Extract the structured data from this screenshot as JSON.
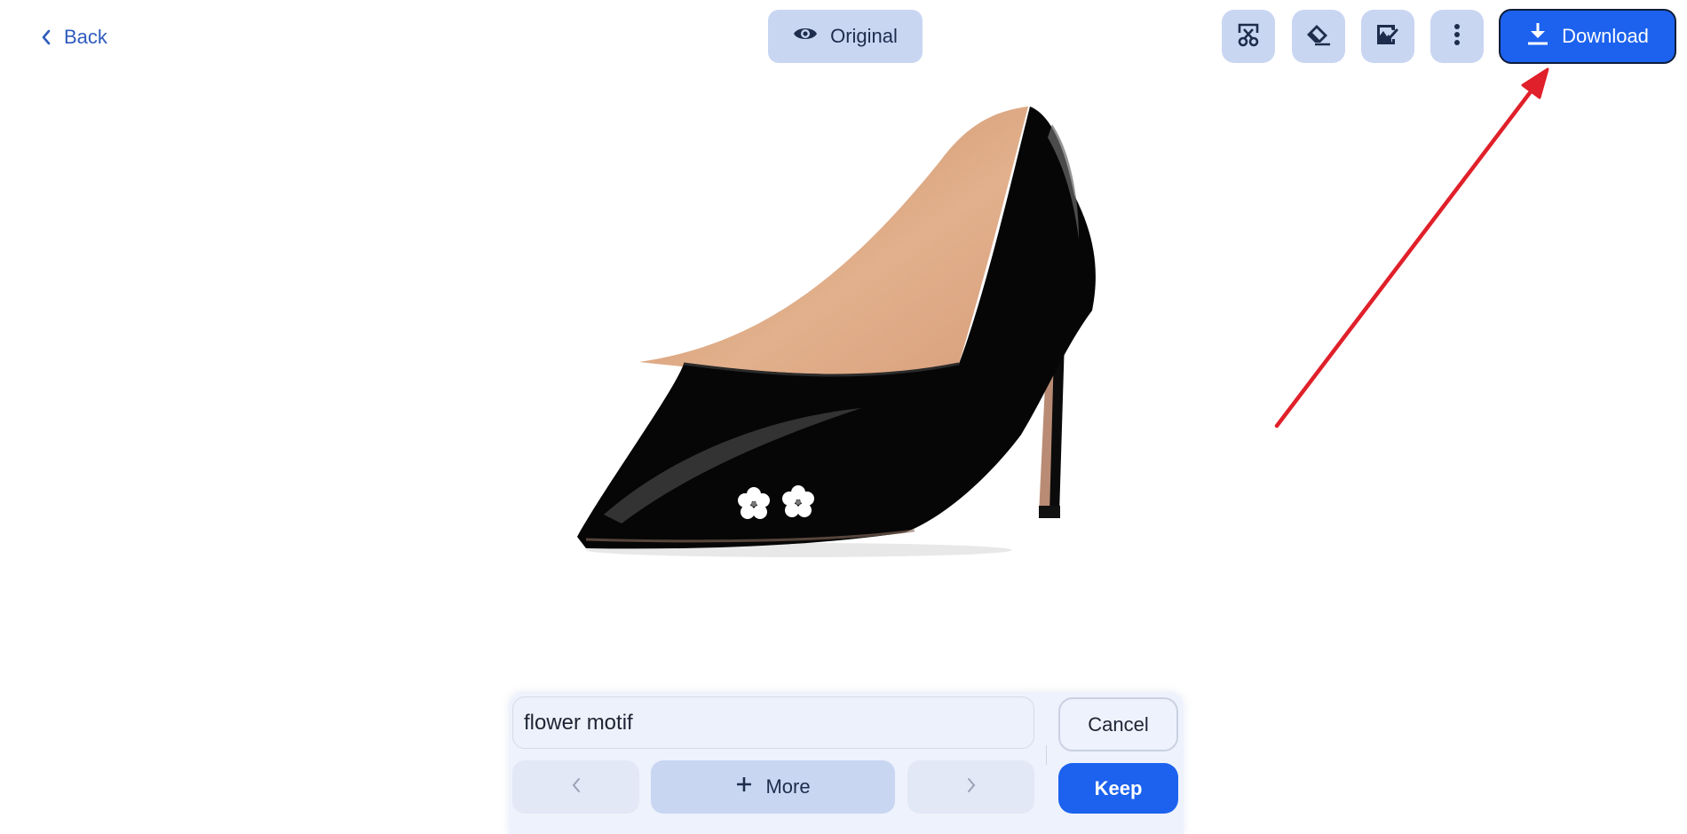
{
  "header": {
    "back_label": "Back",
    "back_icon": "chevron-left-icon",
    "original_label": "Original",
    "original_icon": "eye-icon",
    "tools": [
      {
        "name": "cutout",
        "icon": "scissors-crop-icon"
      },
      {
        "name": "eraser",
        "icon": "eraser-icon"
      },
      {
        "name": "edit-image",
        "icon": "image-edit-icon"
      },
      {
        "name": "more-options",
        "icon": "vertical-dots-icon"
      }
    ],
    "download_label": "Download",
    "download_icon": "download-icon"
  },
  "canvas": {
    "subject": "black patent leather pointed-toe high heel pump with two white flower motifs",
    "annotation": "red arrow pointing to Download button"
  },
  "edit_panel": {
    "prompt_value": "flower motif",
    "prompt_placeholder": "",
    "prev_icon": "chevron-left-icon",
    "more_label": "More",
    "more_icon": "plus-icon",
    "next_icon": "chevron-right-icon",
    "cancel_label": "Cancel",
    "keep_label": "Keep"
  },
  "colors": {
    "accent": "#1c62ee",
    "button_bg": "#c9d6f2",
    "link": "#2f5bbd",
    "annotation": "#e0202a"
  }
}
